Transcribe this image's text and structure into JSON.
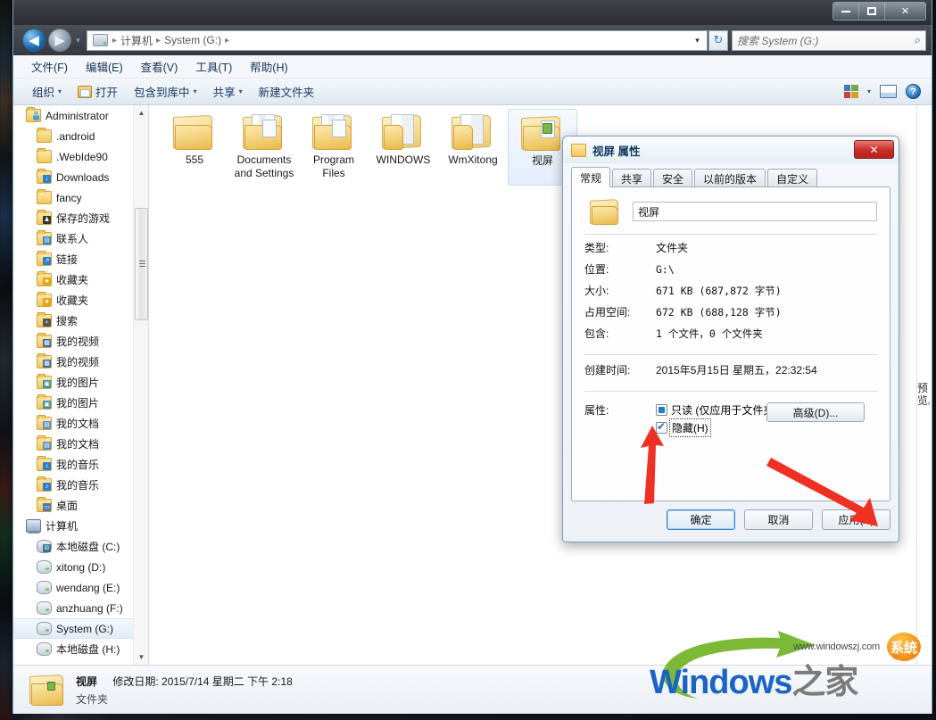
{
  "window": {
    "controls": {
      "minimize": "−",
      "maximize": "□",
      "close": "✕"
    }
  },
  "addressbar": {
    "back_icon": "◀",
    "forward_icon": "▶",
    "history_icon": "▾",
    "crumbs": [
      "计算机",
      "System (G:)"
    ],
    "separator": "▸",
    "dropdown_icon": "▾",
    "refresh_icon": "↻"
  },
  "search": {
    "placeholder": "搜索 System (G:)",
    "icon": "⌕"
  },
  "menubar": {
    "items": [
      "文件(F)",
      "编辑(E)",
      "查看(V)",
      "工具(T)",
      "帮助(H)"
    ]
  },
  "toolbar": {
    "organize": "组织",
    "open": "打开",
    "include_in_library": "包含到库中",
    "share": "共享",
    "new_folder": "新建文件夹",
    "caret": "▾",
    "help_glyph": "?"
  },
  "navpane": {
    "scroll_up": "▲",
    "scroll_down": "▼",
    "items": [
      {
        "label": "Administrator",
        "icon": "user-folder",
        "level": 0
      },
      {
        "label": ".android",
        "icon": "folder",
        "level": 1
      },
      {
        "label": ".WebIde90",
        "icon": "folder",
        "level": 1
      },
      {
        "label": "Downloads",
        "icon": "folder-download",
        "level": 1
      },
      {
        "label": "fancy",
        "icon": "folder",
        "level": 1
      },
      {
        "label": "保存的游戏",
        "icon": "folder-games",
        "level": 1
      },
      {
        "label": "联系人",
        "icon": "folder-contacts",
        "level": 1
      },
      {
        "label": "链接",
        "icon": "folder-links",
        "level": 1
      },
      {
        "label": "收藏夹",
        "icon": "folder-favorites",
        "level": 1
      },
      {
        "label": "收藏夹",
        "icon": "folder-favorites",
        "level": 1
      },
      {
        "label": "搜索",
        "icon": "folder-search",
        "level": 1
      },
      {
        "label": "我的视频",
        "icon": "folder-video",
        "level": 1
      },
      {
        "label": "我的视频",
        "icon": "folder-video",
        "level": 1
      },
      {
        "label": "我的图片",
        "icon": "folder-pictures",
        "level": 1
      },
      {
        "label": "我的图片",
        "icon": "folder-pictures",
        "level": 1
      },
      {
        "label": "我的文档",
        "icon": "folder-documents",
        "level": 1
      },
      {
        "label": "我的文档",
        "icon": "folder-documents",
        "level": 1
      },
      {
        "label": "我的音乐",
        "icon": "folder-music",
        "level": 1
      },
      {
        "label": "我的音乐",
        "icon": "folder-music",
        "level": 1
      },
      {
        "label": "桌面",
        "icon": "folder-desktop",
        "level": 1
      },
      {
        "label": "计算机",
        "icon": "computer",
        "level": 0
      },
      {
        "label": "本地磁盘 (C:)",
        "icon": "drive-system",
        "level": 1
      },
      {
        "label": "xitong (D:)",
        "icon": "drive",
        "level": 1
      },
      {
        "label": "wendang (E:)",
        "icon": "drive",
        "level": 1
      },
      {
        "label": "anzhuang (F:)",
        "icon": "drive",
        "level": 1
      },
      {
        "label": "System (G:)",
        "icon": "drive",
        "level": 1,
        "selected": true
      },
      {
        "label": "本地磁盘 (H:)",
        "icon": "drive",
        "level": 1
      }
    ]
  },
  "files": [
    {
      "name": "555",
      "icon": "folder-empty",
      "selected": false
    },
    {
      "name": "Documents and Settings",
      "icon": "folder-full",
      "selected": false
    },
    {
      "name": "Program Files",
      "icon": "folder-full",
      "selected": false
    },
    {
      "name": "WINDOWS",
      "icon": "folder-docs",
      "selected": false
    },
    {
      "name": "WmXitong",
      "icon": "folder-docs",
      "selected": false
    },
    {
      "name": "视屏",
      "icon": "folder-green",
      "selected": true
    }
  ],
  "preview_pane": {
    "text": "预览。"
  },
  "statusbar": {
    "name": "视屏",
    "modified_label": "修改日期:",
    "modified_value": "2015/7/14 星期二 下午 2:18",
    "type": "文件夹"
  },
  "watermark": {
    "url": "www.windowszj.com",
    "bubble": "系统",
    "brand_en": "Windows",
    "brand_cn": "之家"
  },
  "dialog": {
    "title": "视屏 属性",
    "close_glyph": "✕",
    "tabs": [
      {
        "label": "常规",
        "active": true
      },
      {
        "label": "共享",
        "active": false
      },
      {
        "label": "安全",
        "active": false
      },
      {
        "label": "以前的版本",
        "active": false
      },
      {
        "label": "自定义",
        "active": false
      }
    ],
    "name_value": "视屏",
    "rows": [
      {
        "key": "类型:",
        "value": "文件夹",
        "mono": false
      },
      {
        "key": "位置:",
        "value": "G:\\",
        "mono": true
      },
      {
        "key": "大小:",
        "value": "671 KB (687,872 字节)",
        "mono": true
      },
      {
        "key": "占用空间:",
        "value": "672 KB (688,128 字节)",
        "mono": true
      },
      {
        "key": "包含:",
        "value": "1 个文件，0 个文件夹",
        "mono": true
      }
    ],
    "created_key": "创建时间:",
    "created_value": "2015年5月15日 星期五，22:32:54",
    "attributes_key": "属性:",
    "readonly_label": "只读 (仅应用于文件夹中的文件) (R)",
    "readonly_state": "indeterminate",
    "hidden_label": "隐藏(H)",
    "hidden_state": "checked",
    "advanced_button": "高级(D)...",
    "buttons": [
      {
        "label": "确定",
        "default": true
      },
      {
        "label": "取消",
        "default": false
      },
      {
        "label": "应用(A)",
        "default": false
      }
    ]
  },
  "colors": {
    "accent_blue": "#1b64c4",
    "annotation_red": "#ef3124",
    "folder_yellow": "#f3c65c",
    "selection_blue": "#e4eefb"
  }
}
